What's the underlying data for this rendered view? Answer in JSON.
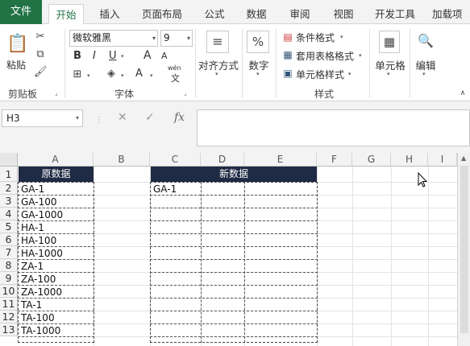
{
  "tabs": {
    "file": "文件",
    "items": [
      "开始",
      "插入",
      "页面布局",
      "公式",
      "数据",
      "审阅",
      "视图",
      "开发工具",
      "加载项"
    ]
  },
  "ribbon": {
    "clipboard": {
      "paste": "粘贴",
      "group": "剪贴板"
    },
    "font": {
      "name": "微软雅黑",
      "size": "9",
      "group": "字体",
      "bold": "B",
      "italic": "I",
      "underline": "U",
      "grow": "A",
      "shrink": "A",
      "fontcolor": "A",
      "wen": "wén",
      "wen2": "文"
    },
    "alignment": {
      "label": "对齐方式"
    },
    "number": {
      "label": "数字",
      "symbol": "%"
    },
    "styles": {
      "cond": "条件格式",
      "table": "套用表格格式",
      "cell": "单元格样式",
      "group": "样式"
    },
    "cells": {
      "label": "单元格"
    },
    "editing": {
      "label": "编辑"
    }
  },
  "formula_bar": {
    "name_box": "H3",
    "cancel": "✕",
    "enter": "✓",
    "fx": "fx",
    "value": ""
  },
  "columns": [
    "A",
    "B",
    "C",
    "D",
    "E",
    "F",
    "G",
    "H",
    "I"
  ],
  "rows": [
    "1",
    "2",
    "3",
    "4",
    "5",
    "6",
    "7",
    "8",
    "9",
    "10",
    "11",
    "12",
    "13"
  ],
  "sheet": {
    "header_a": "原数据",
    "header_cde": "新数据",
    "col_a": [
      "GA-1",
      "GA-100",
      "GA-1000",
      "HA-1",
      "HA-100",
      "HA-1000",
      "ZA-1",
      "ZA-100",
      "ZA-1000",
      "TA-1",
      "TA-100",
      "TA-1000"
    ],
    "c2": "GA-1"
  },
  "colors": {
    "accent": "#217346",
    "header_fill": "#1f2a44"
  }
}
